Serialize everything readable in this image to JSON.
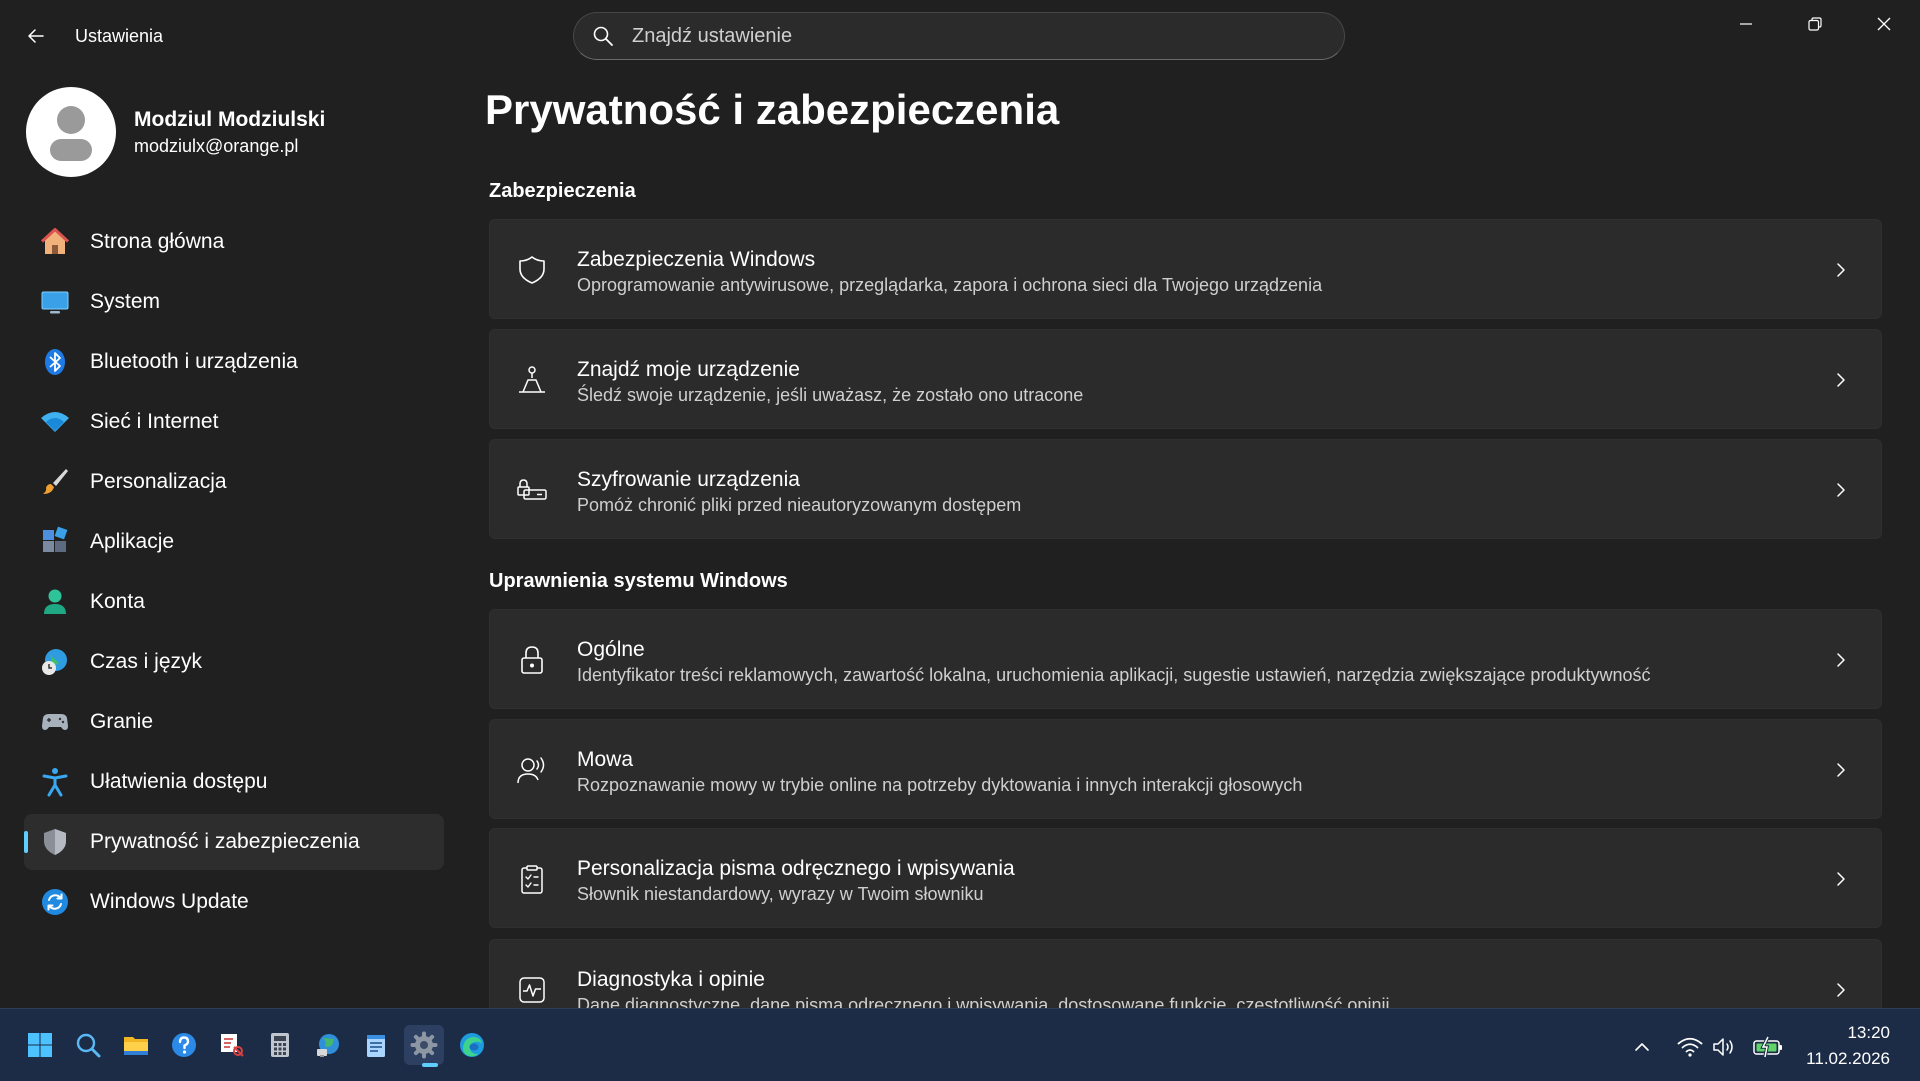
{
  "window": {
    "title": "Ustawienia"
  },
  "search": {
    "placeholder": "Znajdź ustawienie"
  },
  "profile": {
    "name": "Modziul Modziulski",
    "email": "modziulx@orange.pl"
  },
  "sidebar": {
    "items": [
      {
        "label": "Strona główna",
        "icon": "home-icon"
      },
      {
        "label": "System",
        "icon": "monitor-icon"
      },
      {
        "label": "Bluetooth i urządzenia",
        "icon": "bluetooth-icon"
      },
      {
        "label": "Sieć i Internet",
        "icon": "wifi-icon"
      },
      {
        "label": "Personalizacja",
        "icon": "brush-icon"
      },
      {
        "label": "Aplikacje",
        "icon": "apps-icon"
      },
      {
        "label": "Konta",
        "icon": "person-icon"
      },
      {
        "label": "Czas i język",
        "icon": "globe-clock-icon"
      },
      {
        "label": "Granie",
        "icon": "gamepad-icon"
      },
      {
        "label": "Ułatwienia dostępu",
        "icon": "accessibility-icon"
      },
      {
        "label": "Prywatność i zabezpieczenia",
        "icon": "shield-icon",
        "selected": true
      },
      {
        "label": "Windows Update",
        "icon": "update-icon"
      }
    ]
  },
  "main": {
    "title": "Prywatność i zabezpieczenia",
    "sections": [
      {
        "title": "Zabezpieczenia",
        "cards": [
          {
            "title": "Zabezpieczenia Windows",
            "description": "Oprogramowanie antywirusowe, przeglądarka, zapora i ochrona sieci dla Twojego urządzenia",
            "icon": "shield-outline-icon"
          },
          {
            "title": "Znajdź moje urządzenie",
            "description": "Śledź swoje urządzenie, jeśli uważasz, że zostało ono utracone",
            "icon": "find-device-icon"
          },
          {
            "title": "Szyfrowanie urządzenia",
            "description": "Pomóż chronić pliki przed nieautoryzowanym dostępem",
            "icon": "encryption-icon"
          }
        ]
      },
      {
        "title": "Uprawnienia systemu Windows",
        "cards": [
          {
            "title": "Ogólne",
            "description": "Identyfikator treści reklamowych, zawartość lokalna, uruchomienia aplikacji, sugestie ustawień, narzędzia zwiększające produktywność",
            "icon": "lock-icon"
          },
          {
            "title": "Mowa",
            "description": "Rozpoznawanie mowy w trybie online na potrzeby dyktowania i innych interakcji głosowych",
            "icon": "speech-icon"
          },
          {
            "title": "Personalizacja pisma odręcznego i wpisywania",
            "description": "Słownik niestandardowy, wyrazy w Twoim słowniku",
            "icon": "clipboard-check-icon"
          },
          {
            "title": "Diagnostyka i opinie",
            "description": "Dane diagnostyczne, dane pisma odręcznego i wpisywania, dostosowane funkcje, częstotliwość opinii",
            "icon": "diagnostics-icon"
          }
        ]
      }
    ]
  },
  "taskbar": {
    "apps": [
      "start-icon",
      "search-icon",
      "file-explorer-icon",
      "help-icon",
      "snipping-tool-icon",
      "calculator-icon",
      "network-globe-icon",
      "notepad-icon",
      "settings-gear-icon",
      "edge-icon"
    ],
    "active_app": "settings-gear-icon",
    "time": "13:20",
    "date": "11.02.2026"
  },
  "colors": {
    "background": "#202020",
    "card": "#2b2b2b",
    "accent": "#60cdff",
    "taskbar": "#1c2c46"
  }
}
